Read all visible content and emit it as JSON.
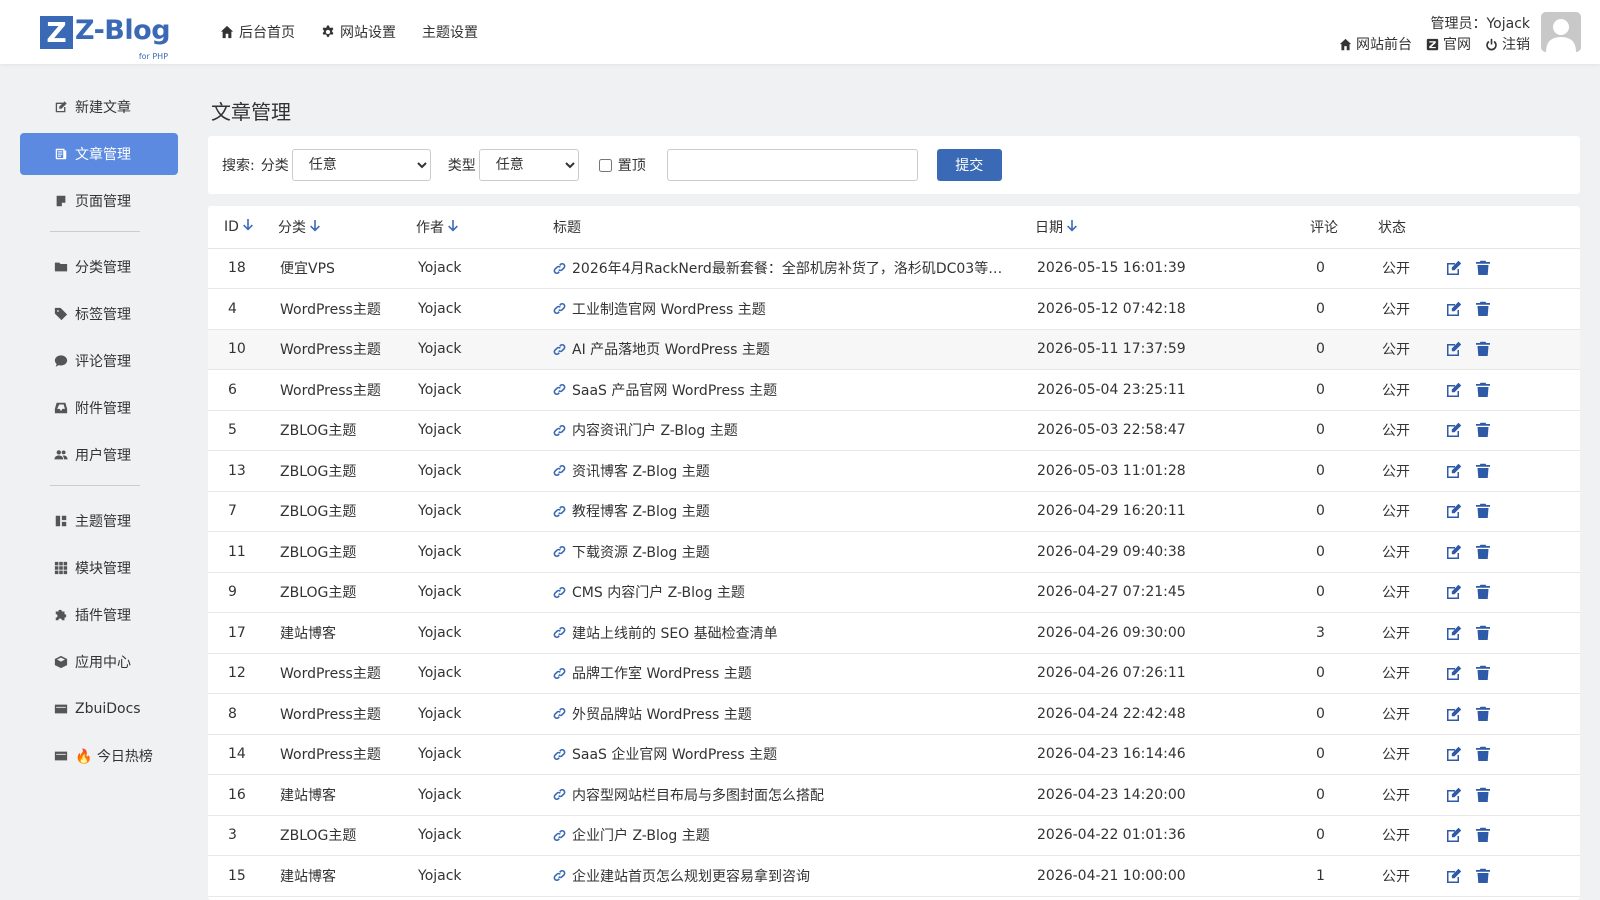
{
  "header": {
    "logo_letter": "Z",
    "logo_text": "Z-Blog",
    "logo_sub": "for PHP",
    "nav": [
      {
        "label": "后台首页",
        "icon": "home-icon"
      },
      {
        "label": "网站设置",
        "icon": "gear-icon"
      },
      {
        "label": "主题设置",
        "icon": ""
      }
    ],
    "admin_label": "管理员：Yojack",
    "links": [
      {
        "label": "网站前台",
        "icon": "home-icon"
      },
      {
        "label": "官网",
        "icon": "z-logo-icon"
      },
      {
        "label": "注销",
        "icon": "power-icon"
      }
    ]
  },
  "sidebar": {
    "items": [
      {
        "label": "新建文章",
        "icon": "edit-icon"
      },
      {
        "label": "文章管理",
        "icon": "article-icon",
        "active": true
      },
      {
        "label": "页面管理",
        "icon": "page-icon"
      },
      {
        "label": "分类管理",
        "icon": "folder-icon"
      },
      {
        "label": "标签管理",
        "icon": "tag-icon"
      },
      {
        "label": "评论管理",
        "icon": "comment-icon"
      },
      {
        "label": "附件管理",
        "icon": "inbox-icon"
      },
      {
        "label": "用户管理",
        "icon": "users-icon"
      },
      {
        "label": "主题管理",
        "icon": "theme-icon"
      },
      {
        "label": "模块管理",
        "icon": "grid-icon"
      },
      {
        "label": "插件管理",
        "icon": "puzzle-icon"
      },
      {
        "label": "应用中心",
        "icon": "box-icon"
      },
      {
        "label": "ZbuiDocs",
        "icon": "card-icon"
      },
      {
        "label": "🔥 今日热榜",
        "icon": "card-icon"
      }
    ]
  },
  "page_title": "文章管理",
  "search": {
    "label": "搜索:",
    "category_label": "分类",
    "category_value": "任意",
    "type_label": "类型",
    "type_value": "任意",
    "top_label": "置顶",
    "keyword_placeholder": "",
    "submit_label": "提交"
  },
  "table": {
    "headers": {
      "id": "ID",
      "category": "分类",
      "author": "作者",
      "title": "标题",
      "date": "日期",
      "comments": "评论",
      "status": "状态"
    },
    "rows": [
      {
        "id": "18",
        "category": "便宜VPS",
        "author": "Yojack",
        "title": "2026年4月RackNerd最新套餐：全部机房补货了，洛杉矶DC03等…",
        "date": "2026-05-15 16:01:39",
        "comments": "0",
        "status": "公开"
      },
      {
        "id": "4",
        "category": "WordPress主题",
        "author": "Yojack",
        "title": "工业制造官网 WordPress 主题",
        "date": "2026-05-12 07:42:18",
        "comments": "0",
        "status": "公开"
      },
      {
        "id": "10",
        "category": "WordPress主题",
        "author": "Yojack",
        "title": "AI 产品落地页 WordPress 主题",
        "date": "2026-05-11 17:37:59",
        "comments": "0",
        "status": "公开"
      },
      {
        "id": "6",
        "category": "WordPress主题",
        "author": "Yojack",
        "title": "SaaS 产品官网 WordPress 主题",
        "date": "2026-05-04 23:25:11",
        "comments": "0",
        "status": "公开"
      },
      {
        "id": "5",
        "category": "ZBLOG主题",
        "author": "Yojack",
        "title": "内容资讯门户 Z-Blog 主题",
        "date": "2026-05-03 22:58:47",
        "comments": "0",
        "status": "公开"
      },
      {
        "id": "13",
        "category": "ZBLOG主题",
        "author": "Yojack",
        "title": "资讯博客 Z-Blog 主题",
        "date": "2026-05-03 11:01:28",
        "comments": "0",
        "status": "公开"
      },
      {
        "id": "7",
        "category": "ZBLOG主题",
        "author": "Yojack",
        "title": "教程博客 Z-Blog 主题",
        "date": "2026-04-29 16:20:11",
        "comments": "0",
        "status": "公开"
      },
      {
        "id": "11",
        "category": "ZBLOG主题",
        "author": "Yojack",
        "title": "下载资源 Z-Blog 主题",
        "date": "2026-04-29 09:40:38",
        "comments": "0",
        "status": "公开"
      },
      {
        "id": "9",
        "category": "ZBLOG主题",
        "author": "Yojack",
        "title": "CMS 内容门户 Z-Blog 主题",
        "date": "2026-04-27 07:21:45",
        "comments": "0",
        "status": "公开"
      },
      {
        "id": "17",
        "category": "建站博客",
        "author": "Yojack",
        "title": "建站上线前的 SEO 基础检查清单",
        "date": "2026-04-26 09:30:00",
        "comments": "3",
        "status": "公开"
      },
      {
        "id": "12",
        "category": "WordPress主题",
        "author": "Yojack",
        "title": "品牌工作室 WordPress 主题",
        "date": "2026-04-26 07:26:11",
        "comments": "0",
        "status": "公开"
      },
      {
        "id": "8",
        "category": "WordPress主题",
        "author": "Yojack",
        "title": "外贸品牌站 WordPress 主题",
        "date": "2026-04-24 22:42:48",
        "comments": "0",
        "status": "公开"
      },
      {
        "id": "14",
        "category": "WordPress主题",
        "author": "Yojack",
        "title": "SaaS 企业官网 WordPress 主题",
        "date": "2026-04-23 16:14:46",
        "comments": "0",
        "status": "公开"
      },
      {
        "id": "16",
        "category": "建站博客",
        "author": "Yojack",
        "title": "内容型网站栏目布局与多图封面怎么搭配",
        "date": "2026-04-23 14:20:00",
        "comments": "0",
        "status": "公开"
      },
      {
        "id": "3",
        "category": "ZBLOG主题",
        "author": "Yojack",
        "title": "企业门户 Z-Blog 主题",
        "date": "2026-04-22 01:01:36",
        "comments": "0",
        "status": "公开"
      },
      {
        "id": "15",
        "category": "建站博客",
        "author": "Yojack",
        "title": "企业建站首页怎么规划更容易拿到咨询",
        "date": "2026-04-21 10:00:00",
        "comments": "1",
        "status": "公开"
      }
    ]
  },
  "colors": {
    "accent": "#3a6ab5",
    "sidebar_active": "#5b8ae0",
    "background": "#f0f1f3"
  }
}
